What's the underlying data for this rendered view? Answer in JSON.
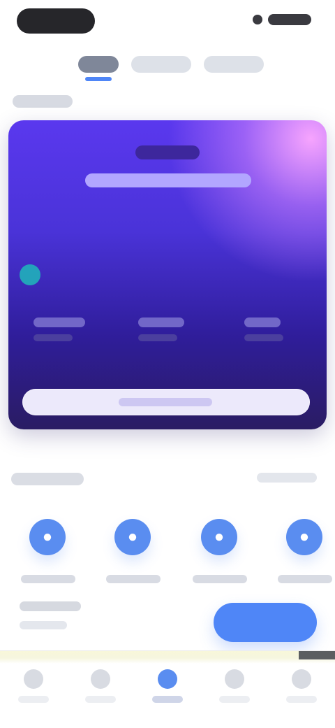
{
  "status_bar": {
    "time": "",
    "signal_icon": "signal-icon",
    "battery_icon": "battery-icon"
  },
  "top_tabs": [
    {
      "label": "",
      "active": true
    },
    {
      "label": "",
      "active": false
    },
    {
      "label": "",
      "active": false
    }
  ],
  "section_label": "",
  "hero": {
    "chip": "",
    "title": "",
    "stats": [
      {
        "value": "",
        "label": ""
      },
      {
        "value": "",
        "label": ""
      },
      {
        "value": "",
        "label": ""
      }
    ],
    "action": ""
  },
  "shortcuts": {
    "title": "",
    "link": "",
    "items": [
      {
        "label": "",
        "icon": "shortcut-icon"
      },
      {
        "label": "",
        "icon": "shortcut-icon"
      },
      {
        "label": "",
        "icon": "shortcut-icon"
      },
      {
        "label": "",
        "icon": "shortcut-icon"
      }
    ]
  },
  "promo": {
    "title": "",
    "subtitle": "",
    "button": ""
  },
  "bottom_nav": [
    {
      "label": "",
      "active": false
    },
    {
      "label": "",
      "active": false
    },
    {
      "label": "",
      "active": true
    },
    {
      "label": "",
      "active": false
    },
    {
      "label": "",
      "active": false
    }
  ],
  "colors": {
    "accent": "#4f86f7",
    "hero_start": "#5a38ee",
    "hero_end": "#2a1c63",
    "teal": "#1fb8ba"
  }
}
